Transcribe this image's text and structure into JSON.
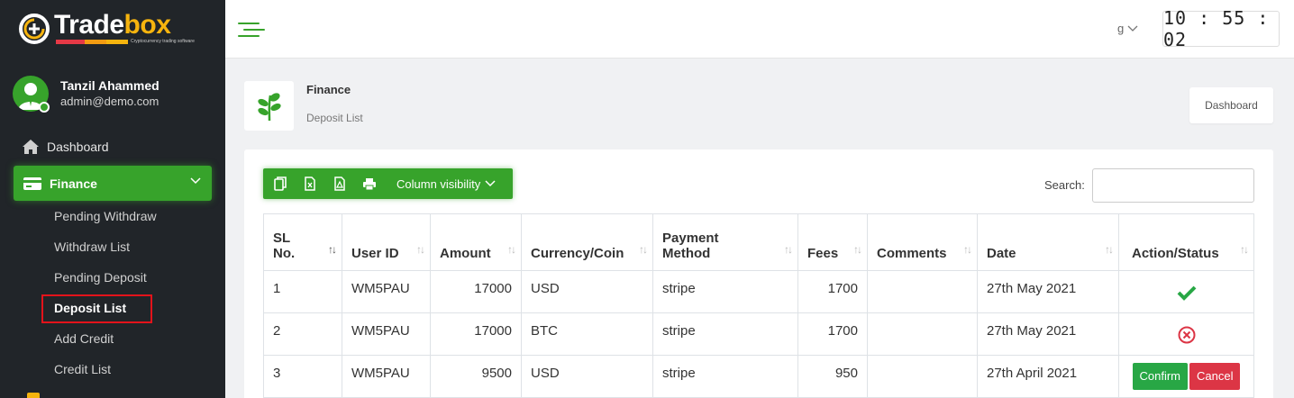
{
  "brand": {
    "name_a": "Trade",
    "name_b": "box",
    "tagline": "Cryptocurrency trading software"
  },
  "user": {
    "name": "Tanzil Ahammed",
    "email": "admin@demo.com"
  },
  "nav": {
    "dashboard": "Dashboard",
    "finance": "Finance",
    "finance_items": [
      "Pending Withdraw",
      "Withdraw List",
      "Pending Deposit",
      "Deposit List",
      "Add Credit",
      "Credit List"
    ],
    "active_item": "Deposit List"
  },
  "header": {
    "language": "g",
    "clock": "10 : 55 : 02"
  },
  "breadcrumb": {
    "title": "Finance",
    "subtitle": "Deposit List",
    "dashboard_button": "Dashboard"
  },
  "toolbar": {
    "column_visibility": "Column visibility",
    "search_label": "Search:",
    "search_value": ""
  },
  "table": {
    "headers": [
      "SL No.",
      "User ID",
      "Amount",
      "Currency/Coin",
      "Payment Method",
      "Fees",
      "Comments",
      "Date",
      "Action/Status"
    ],
    "rows": [
      {
        "sl": "1",
        "user_id": "WM5PAU",
        "amount": "17000",
        "currency": "USD",
        "method": "stripe",
        "fees": "1700",
        "comments": "",
        "date": "27th May 2021",
        "status": "approved"
      },
      {
        "sl": "2",
        "user_id": "WM5PAU",
        "amount": "17000",
        "currency": "BTC",
        "method": "stripe",
        "fees": "1700",
        "comments": "",
        "date": "27th May 2021",
        "status": "rejected"
      },
      {
        "sl": "3",
        "user_id": "WM5PAU",
        "amount": "9500",
        "currency": "USD",
        "method": "stripe",
        "fees": "950",
        "comments": "",
        "date": "27th April 2021",
        "status": "pending"
      }
    ],
    "actions": {
      "confirm": "Confirm",
      "cancel": "Cancel"
    }
  },
  "colors": {
    "accent": "#37a32b",
    "sidebar": "#212529",
    "danger": "#dc3545",
    "highlight": "#e3131b"
  }
}
